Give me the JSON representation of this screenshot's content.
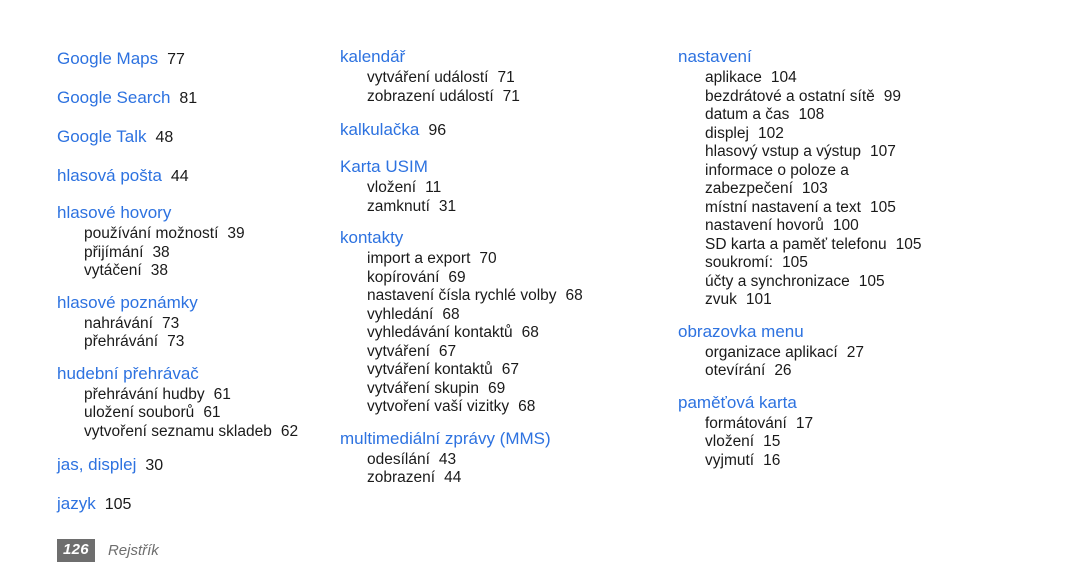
{
  "document": {
    "type": "index",
    "language": "cs",
    "heading_color": "#2d72e0",
    "text_color": "#1a1a1a",
    "footer_color": "#6e6e6e",
    "background_color": "#ffffff"
  },
  "footer": {
    "page_number": "126",
    "section_label": "Rejstřík"
  },
  "columns": [
    {
      "id": "column-1",
      "groups": [
        {
          "head": "Google Maps",
          "head_page": "77",
          "subs": []
        },
        {
          "head": "Google Search",
          "head_page": "81",
          "subs": []
        },
        {
          "head": "Google Talk",
          "head_page": "48",
          "subs": []
        },
        {
          "head": "hlasová pošta",
          "head_page": "44",
          "subs": []
        },
        {
          "head": "hlasové hovory",
          "head_page": "",
          "subs": [
            {
              "label": "používání možností",
              "page": "39"
            },
            {
              "label": "přijímání",
              "page": "38"
            },
            {
              "label": "vytáčení",
              "page": "38"
            }
          ]
        },
        {
          "head": "hlasové poznámky",
          "head_page": "",
          "subs": [
            {
              "label": "nahrávání",
              "page": "73"
            },
            {
              "label": "přehrávání",
              "page": "73"
            }
          ]
        },
        {
          "head": "hudební přehrávač",
          "head_page": "",
          "subs": [
            {
              "label": "přehrávání hudby",
              "page": "61"
            },
            {
              "label": "uložení souborů",
              "page": "61"
            },
            {
              "label": "vytvoření seznamu skladeb",
              "page": "62"
            }
          ]
        },
        {
          "head": "jas, displej",
          "head_page": "30",
          "subs": []
        },
        {
          "head": "jazyk",
          "head_page": "105",
          "subs": []
        }
      ]
    },
    {
      "id": "column-2",
      "groups": [
        {
          "head": "kalendář",
          "head_page": "",
          "subs": [
            {
              "label": "vytváření událostí",
              "page": "71"
            },
            {
              "label": "zobrazení událostí",
              "page": "71"
            }
          ]
        },
        {
          "head": "kalkulačka",
          "head_page": "96",
          "subs": []
        },
        {
          "head": "Karta USIM",
          "head_page": "",
          "subs": [
            {
              "label": "vložení",
              "page": "11"
            },
            {
              "label": "zamknutí",
              "page": "31"
            }
          ]
        },
        {
          "head": "kontakty",
          "head_page": "",
          "subs": [
            {
              "label": "import a export",
              "page": "70"
            },
            {
              "label": "kopírování",
              "page": "69"
            },
            {
              "label": "nastavení čísla rychlé volby",
              "page": "68"
            },
            {
              "label": "vyhledání",
              "page": "68"
            },
            {
              "label": "vyhledávání kontaktů",
              "page": "68"
            },
            {
              "label": "vytváření",
              "page": "67"
            },
            {
              "label": "vytváření kontaktů",
              "page": "67"
            },
            {
              "label": "vytváření skupin",
              "page": "69"
            },
            {
              "label": "vytvoření vaší vizitky",
              "page": "68"
            }
          ]
        },
        {
          "head": "multimediální zprávy (MMS)",
          "head_page": "",
          "subs": [
            {
              "label": "odesílání",
              "page": "43"
            },
            {
              "label": "zobrazení",
              "page": "44"
            }
          ]
        }
      ]
    },
    {
      "id": "column-3",
      "groups": [
        {
          "head": "nastavení",
          "head_page": "",
          "subs": [
            {
              "label": "aplikace",
              "page": "104"
            },
            {
              "label": "bezdrátové a ostatní sítě",
              "page": "99"
            },
            {
              "label": "datum a čas",
              "page": "108"
            },
            {
              "label": "displej",
              "page": "102"
            },
            {
              "label": "hlasový vstup a výstup",
              "page": "107"
            },
            {
              "label": "informace o poloze a zabezpečení",
              "page": "103",
              "wrap": true
            },
            {
              "label": "místní nastavení a text",
              "page": "105"
            },
            {
              "label": "nastavení hovorů",
              "page": "100"
            },
            {
              "label": "SD karta a paměť telefonu",
              "page": "105"
            },
            {
              "label": "soukromí:",
              "page": "105"
            },
            {
              "label": "účty a synchronizace",
              "page": "105"
            },
            {
              "label": "zvuk",
              "page": "101"
            }
          ]
        },
        {
          "head": "obrazovka menu",
          "head_page": "",
          "subs": [
            {
              "label": "organizace aplikací",
              "page": "27"
            },
            {
              "label": "otevírání",
              "page": "26"
            }
          ]
        },
        {
          "head": "paměťová karta",
          "head_page": "",
          "subs": [
            {
              "label": "formátování",
              "page": "17"
            },
            {
              "label": "vložení",
              "page": "15"
            },
            {
              "label": "vyjmutí",
              "page": "16"
            }
          ]
        }
      ]
    }
  ]
}
